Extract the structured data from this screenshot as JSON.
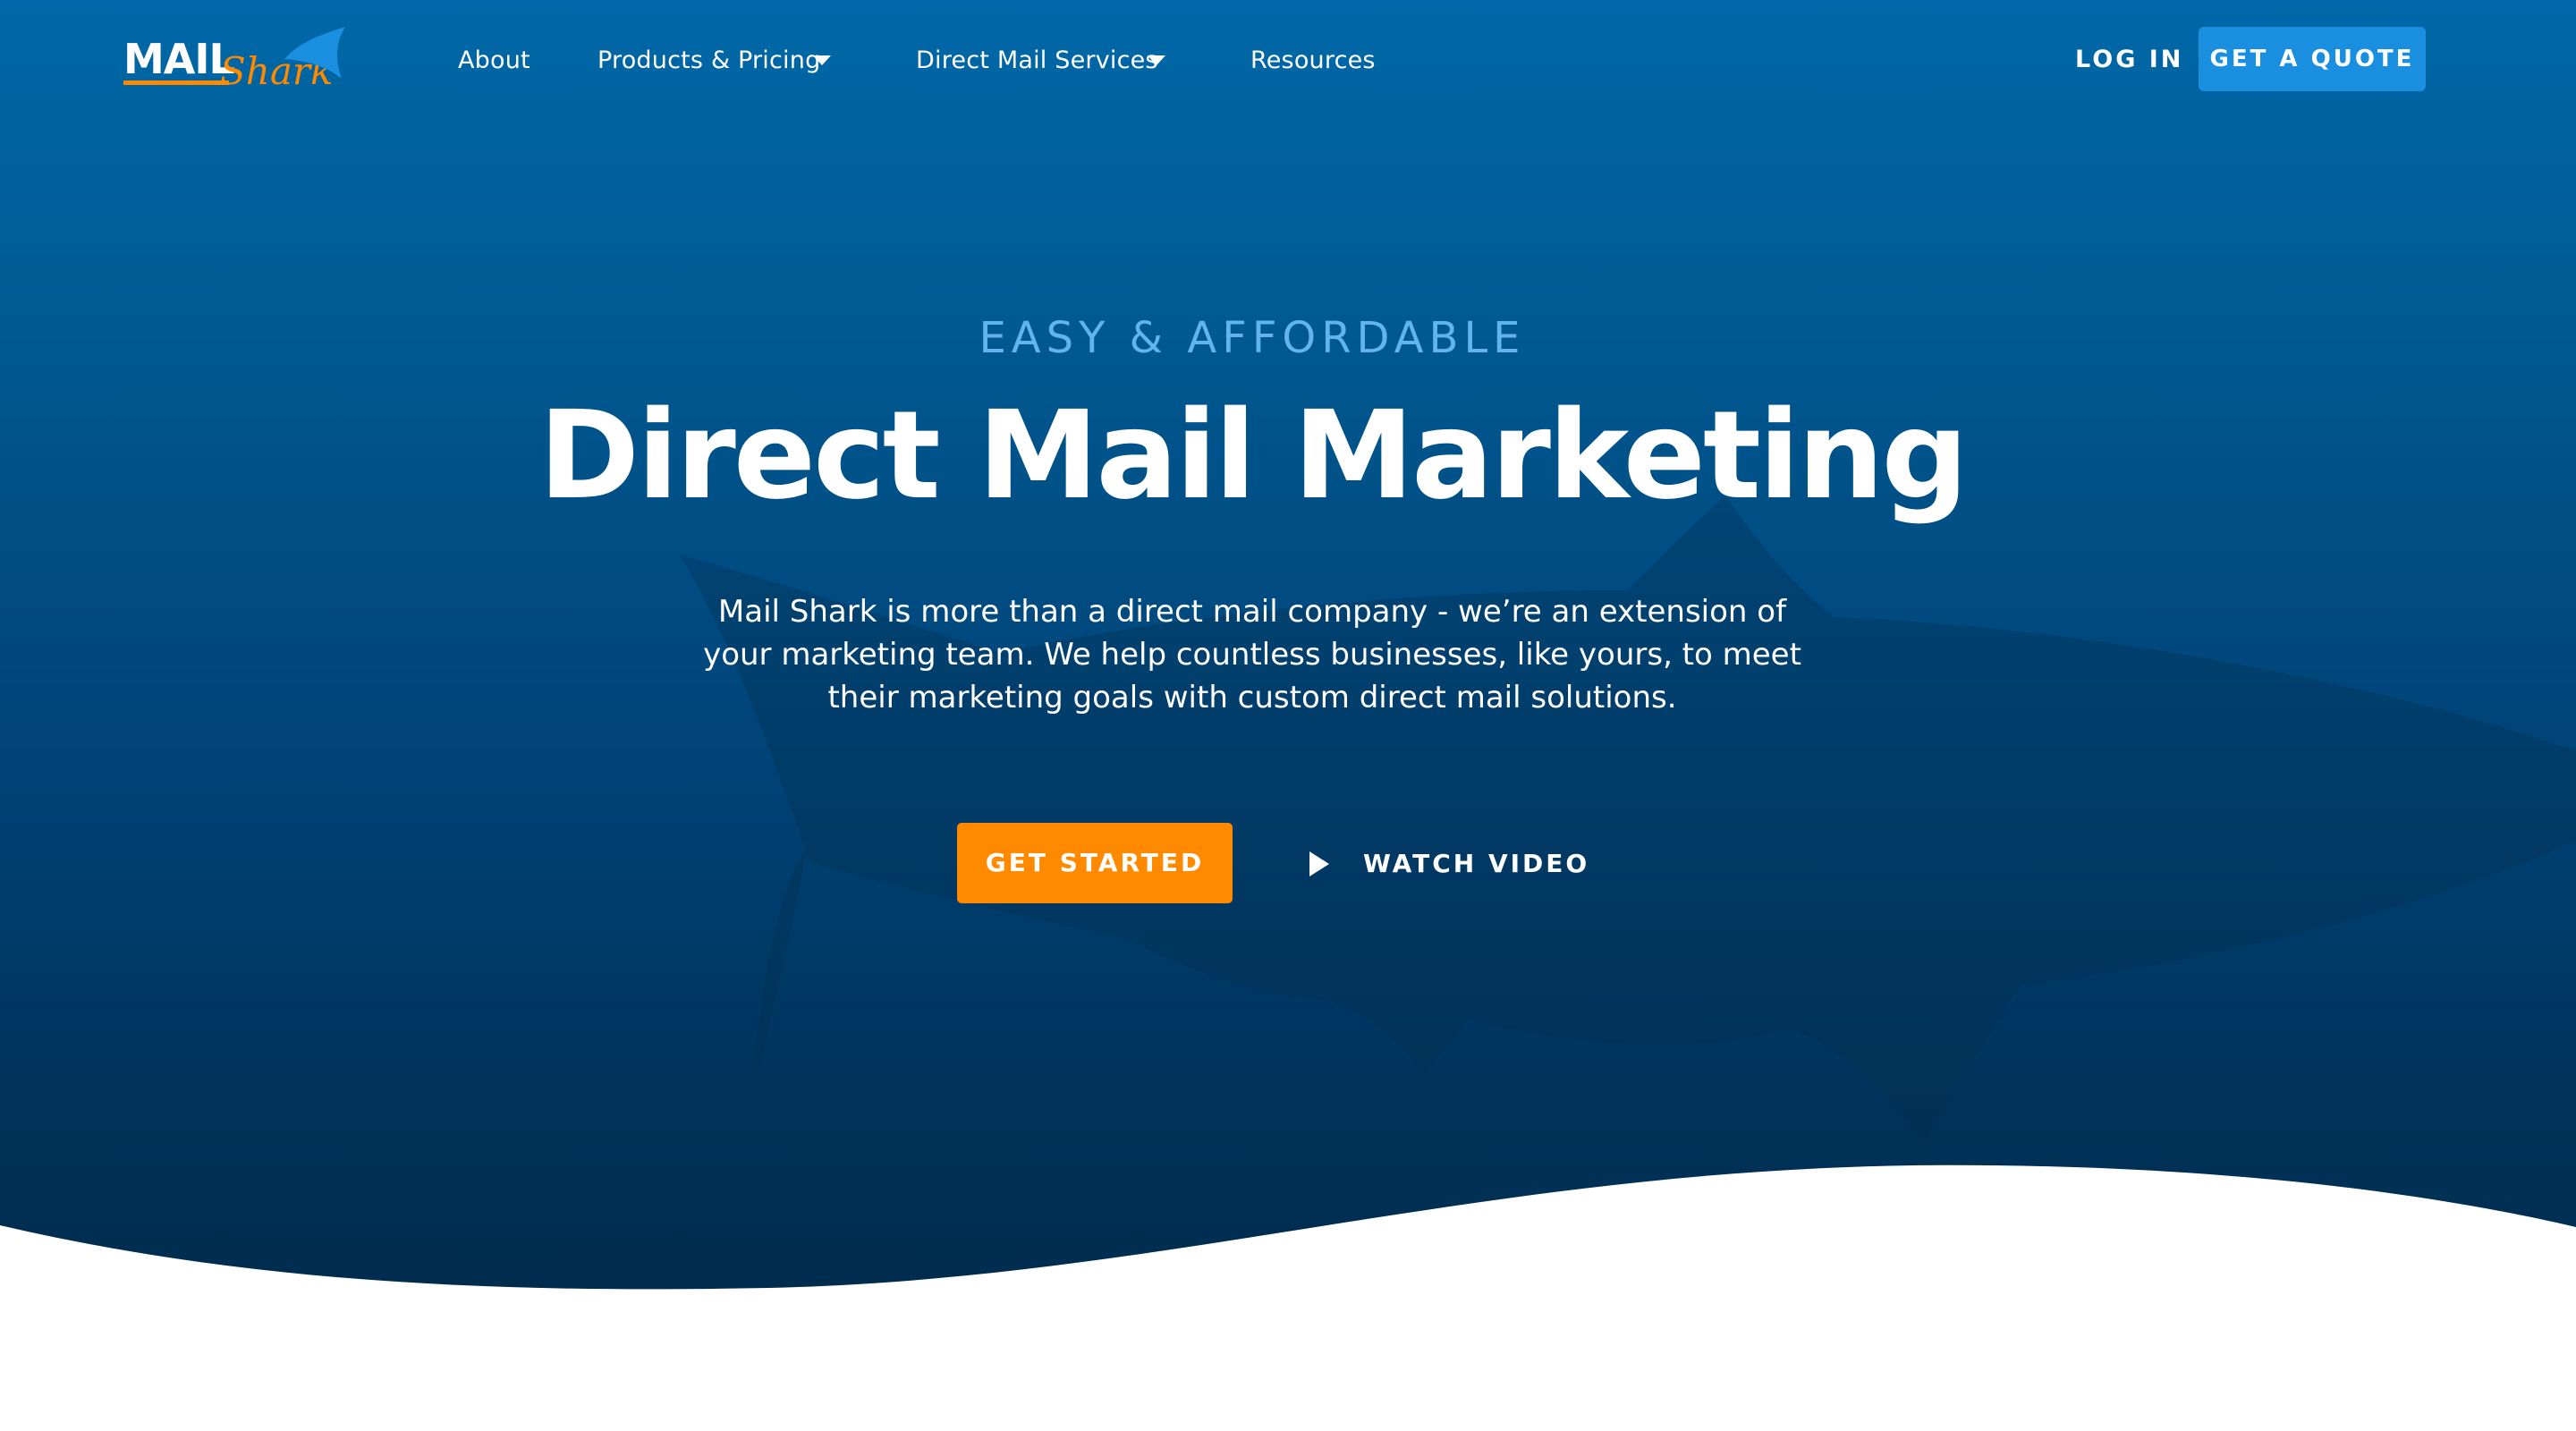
{
  "brand": {
    "logo_text_primary": "MAIL",
    "logo_text_script": "Shark",
    "logo_icon": "shark-fin-icon",
    "colors": {
      "hero_top": "#0068a8",
      "hero_bottom": "#002744",
      "accent_blue": "#1a8fe0",
      "accent_orange": "#ff8a00",
      "eyebrow_blue": "#62b4ec"
    }
  },
  "nav": {
    "items": [
      {
        "label": "About",
        "has_dropdown": false
      },
      {
        "label": "Products & Pricing",
        "has_dropdown": true
      },
      {
        "label": "Direct Mail Services",
        "has_dropdown": true
      },
      {
        "label": "Resources",
        "has_dropdown": false
      }
    ],
    "login_label": "LOG IN",
    "quote_label": "GET A QUOTE"
  },
  "hero": {
    "eyebrow": "EASY & AFFORDABLE",
    "headline": "Direct Mail Marketing",
    "subtext": "Mail Shark is more than a direct mail company - we’re an extension of your marketing team. We help countless businesses, like yours, to meet their marketing goals with custom direct mail solutions.",
    "primary_cta": "GET STARTED",
    "video_cta": "WATCH VIDEO",
    "video_icon": "play-icon"
  }
}
